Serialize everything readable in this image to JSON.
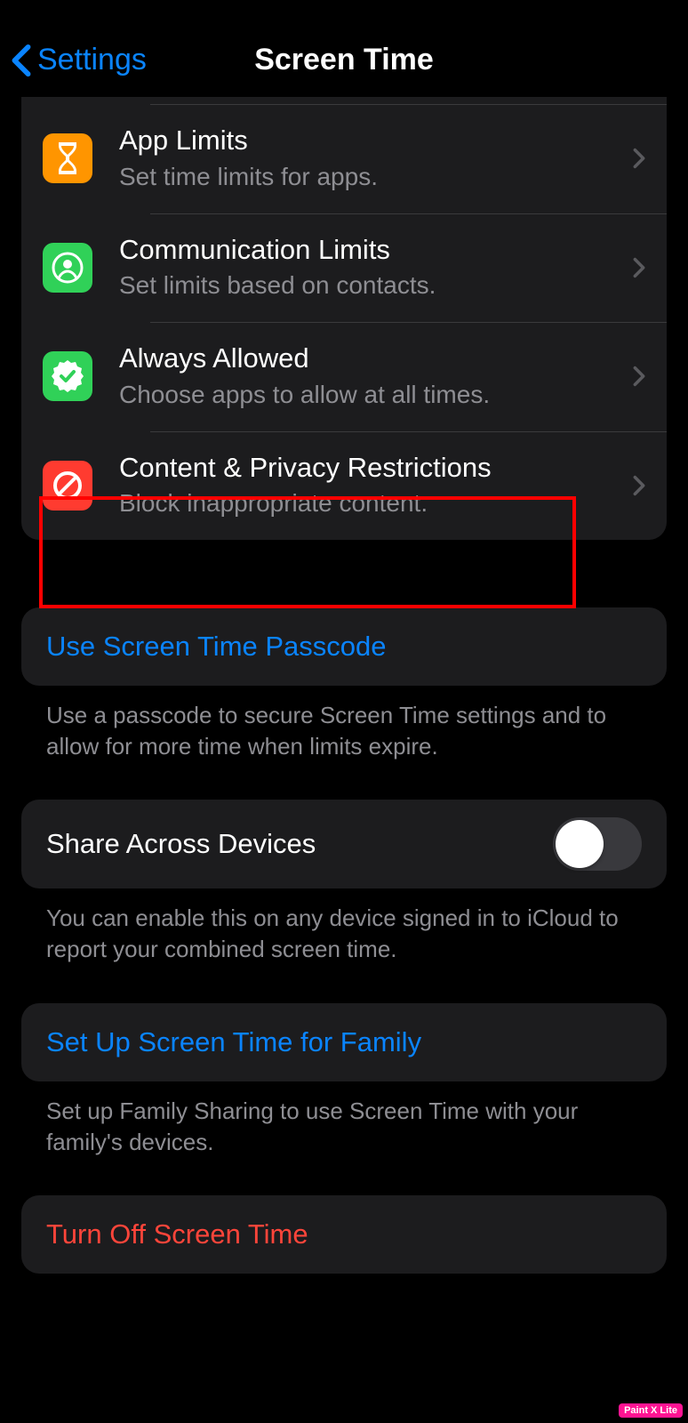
{
  "nav": {
    "back_label": "Settings",
    "title": "Screen Time"
  },
  "rows": {
    "app_limits": {
      "title": "App Limits",
      "subtitle": "Set time limits for apps."
    },
    "communication_limits": {
      "title": "Communication Limits",
      "subtitle": "Set limits based on contacts."
    },
    "always_allowed": {
      "title": "Always Allowed",
      "subtitle": "Choose apps to allow at all times."
    },
    "content_privacy": {
      "title": "Content & Privacy Restrictions",
      "subtitle": "Block inappropriate content."
    }
  },
  "passcode": {
    "label": "Use Screen Time Passcode",
    "footer": "Use a passcode to secure Screen Time settings and to allow for more time when limits expire."
  },
  "share": {
    "label": "Share Across Devices",
    "footer": "You can enable this on any device signed in to iCloud to report your combined screen time."
  },
  "family": {
    "label": "Set Up Screen Time for Family",
    "footer": "Set up Family Sharing to use Screen Time with your family's devices."
  },
  "turn_off": {
    "label": "Turn Off Screen Time"
  },
  "watermark": "Paint X Lite"
}
